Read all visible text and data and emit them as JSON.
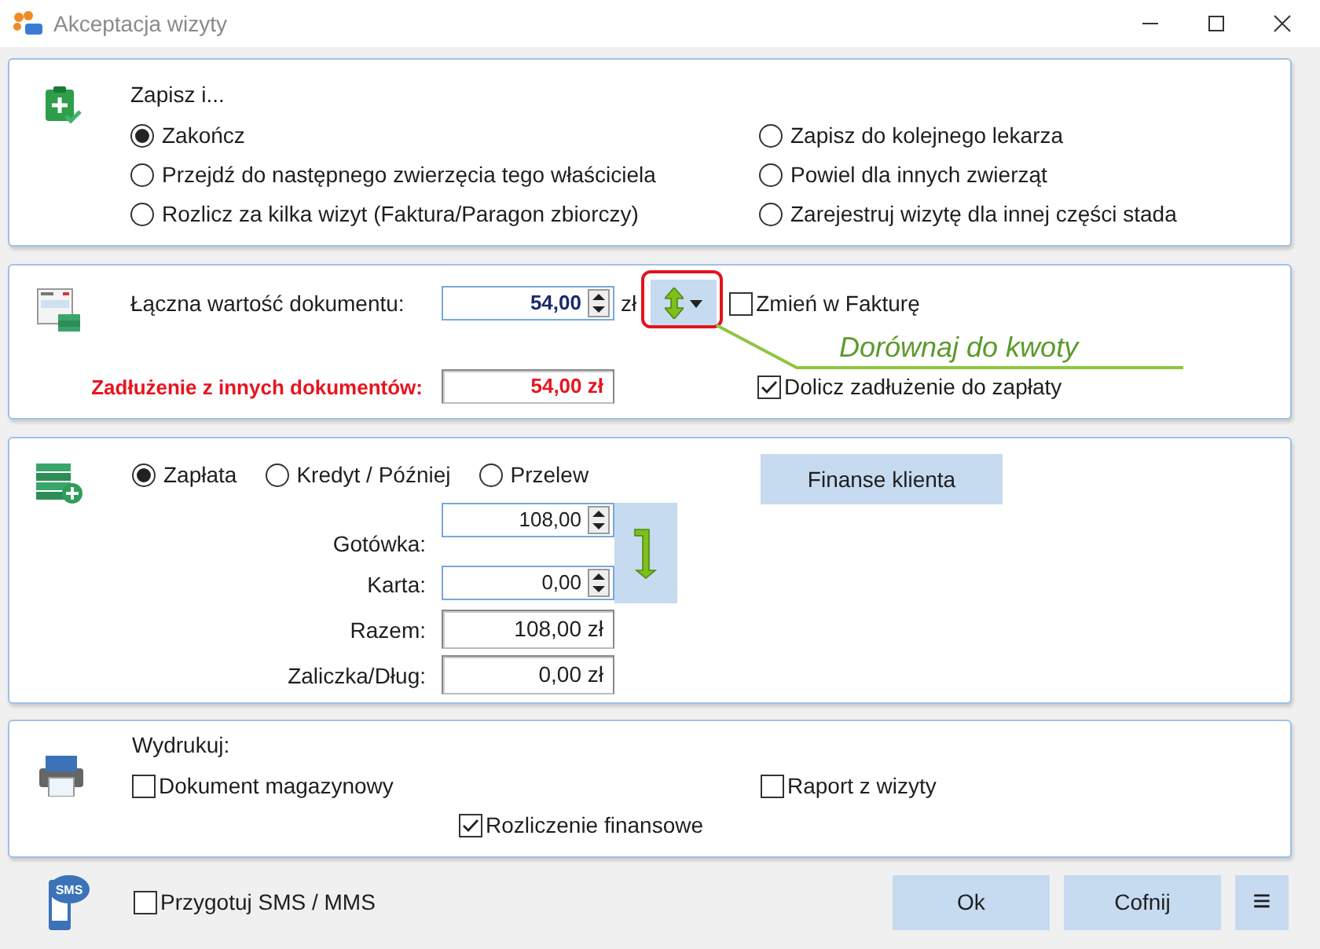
{
  "window": {
    "title": "Akceptacja wizyty"
  },
  "save_section": {
    "heading": "Zapisz i...",
    "options_left": [
      {
        "label": "Zakończ",
        "selected": true
      },
      {
        "label": "Przejdź do następnego zwierzęcia tego właściciela",
        "selected": false
      },
      {
        "label": "Rozlicz za kilka wizyt (Faktura/Paragon zbiorczy)",
        "selected": false
      }
    ],
    "options_right": [
      {
        "label": "Zapisz do kolejnego lekarza",
        "selected": false
      },
      {
        "label": "Powiel dla innych zwierząt",
        "selected": false
      },
      {
        "label": "Zarejestruj wizytę dla innej części stada",
        "selected": false
      }
    ]
  },
  "document_section": {
    "total_label": "Łączna wartość dokumentu:",
    "total_value": "54,00",
    "currency": "zł",
    "change_invoice": {
      "label": "Zmień w Fakturę",
      "checked": false
    },
    "annotation": "Dorównaj do kwoty",
    "debt_label": "Zadłużenie z innych dokumentów:",
    "debt_value": "54,00 zł",
    "add_debt": {
      "label": "Dolicz zadłużenie do zapłaty",
      "checked": true
    }
  },
  "payment_section": {
    "methods": [
      {
        "label": "Zapłata",
        "selected": true
      },
      {
        "label": "Kredyt / Później",
        "selected": false
      },
      {
        "label": "Przelew",
        "selected": false
      }
    ],
    "client_finance_button": "Finanse klienta",
    "fields": [
      {
        "label": "Gotówka:",
        "value": "108,00",
        "kind": "spin"
      },
      {
        "label": "Karta:",
        "value": "0,00",
        "kind": "spin"
      },
      {
        "label": "Razem:",
        "value": "108,00 zł",
        "kind": "readonly"
      },
      {
        "label": "Zaliczka/Dług:",
        "value": "0,00 zł",
        "kind": "readonly"
      }
    ]
  },
  "print_section": {
    "heading": "Wydrukuj:",
    "options": [
      {
        "label": "Dokument magazynowy",
        "checked": false
      },
      {
        "label": "Raport z wizyty",
        "checked": false
      },
      {
        "label": "Rozliczenie finansowe",
        "checked": true
      }
    ]
  },
  "footer": {
    "sms_icon_text": "SMS",
    "sms": {
      "label": "Przygotuj SMS / MMS",
      "checked": false
    },
    "buttons": [
      "Ok",
      "Cofnij"
    ],
    "menu_button": "≡"
  }
}
